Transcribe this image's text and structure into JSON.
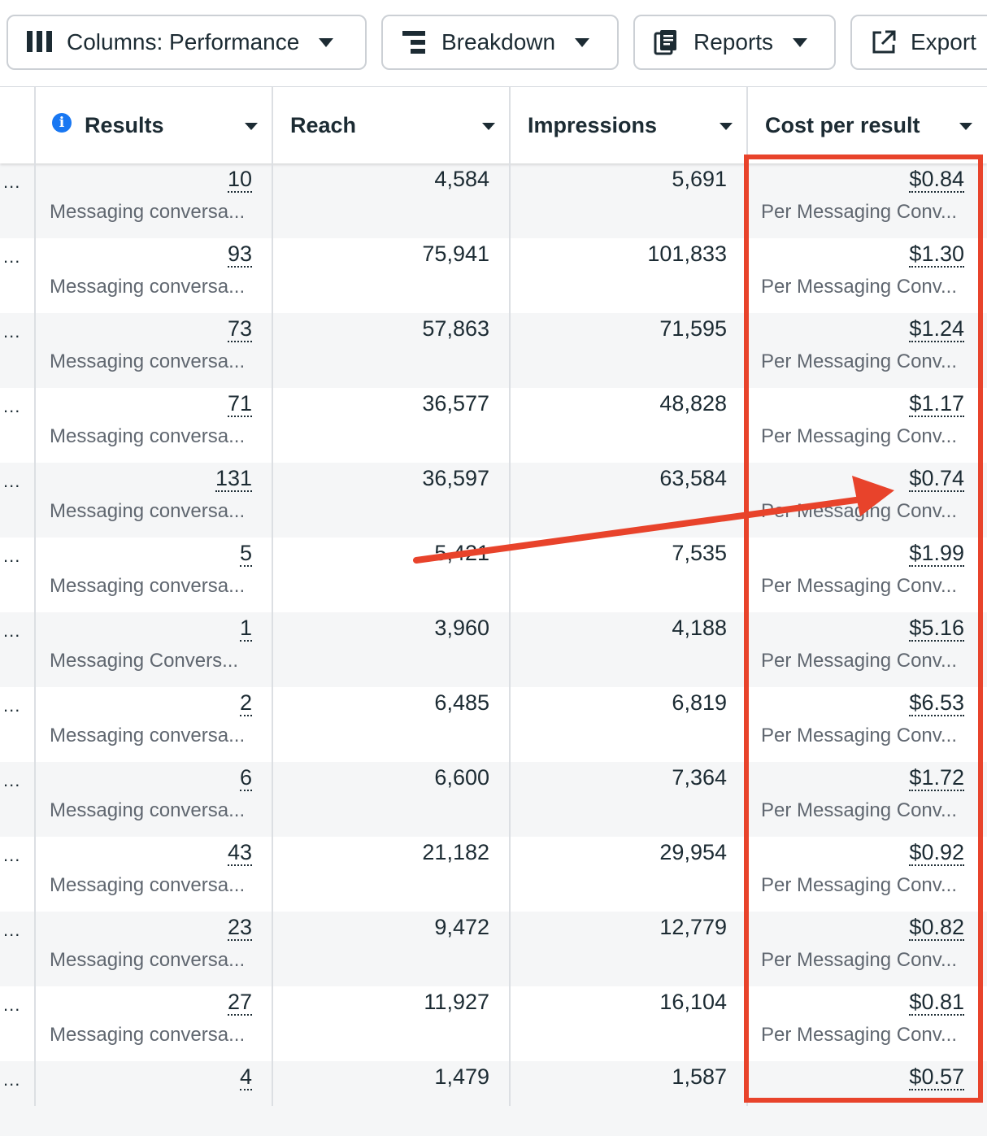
{
  "toolbar": {
    "columns_label": "Columns: Performance",
    "breakdown_label": "Breakdown",
    "reports_label": "Reports",
    "export_label": "Export"
  },
  "table": {
    "headers": {
      "results": "Results",
      "reach": "Reach",
      "impressions": "Impressions",
      "cost_per_result": "Cost per result"
    },
    "row_menu": "...",
    "rows": [
      {
        "results": "10",
        "results_type": "Messaging conversa...",
        "reach": "4,584",
        "impressions": "5,691",
        "cost": "$0.84",
        "cost_type": "Per Messaging Conv..."
      },
      {
        "results": "93",
        "results_type": "Messaging conversa...",
        "reach": "75,941",
        "impressions": "101,833",
        "cost": "$1.30",
        "cost_type": "Per Messaging Conv..."
      },
      {
        "results": "73",
        "results_type": "Messaging conversa...",
        "reach": "57,863",
        "impressions": "71,595",
        "cost": "$1.24",
        "cost_type": "Per Messaging Conv..."
      },
      {
        "results": "71",
        "results_type": "Messaging conversa...",
        "reach": "36,577",
        "impressions": "48,828",
        "cost": "$1.17",
        "cost_type": "Per Messaging Conv..."
      },
      {
        "results": "131",
        "results_type": "Messaging conversa...",
        "reach": "36,597",
        "impressions": "63,584",
        "cost": "$0.74",
        "cost_type": "Per Messaging Conv..."
      },
      {
        "results": "5",
        "results_type": "Messaging conversa...",
        "reach": "5,421",
        "impressions": "7,535",
        "cost": "$1.99",
        "cost_type": "Per Messaging Conv..."
      },
      {
        "results": "1",
        "results_type": "Messaging Convers...",
        "reach": "3,960",
        "impressions": "4,188",
        "cost": "$5.16",
        "cost_type": "Per Messaging Conv..."
      },
      {
        "results": "2",
        "results_type": "Messaging conversa...",
        "reach": "6,485",
        "impressions": "6,819",
        "cost": "$6.53",
        "cost_type": "Per Messaging Conv..."
      },
      {
        "results": "6",
        "results_type": "Messaging conversa...",
        "reach": "6,600",
        "impressions": "7,364",
        "cost": "$1.72",
        "cost_type": "Per Messaging Conv..."
      },
      {
        "results": "43",
        "results_type": "Messaging conversa...",
        "reach": "21,182",
        "impressions": "29,954",
        "cost": "$0.92",
        "cost_type": "Per Messaging Conv..."
      },
      {
        "results": "23",
        "results_type": "Messaging conversa...",
        "reach": "9,472",
        "impressions": "12,779",
        "cost": "$0.82",
        "cost_type": "Per Messaging Conv..."
      },
      {
        "results": "27",
        "results_type": "Messaging conversa...",
        "reach": "11,927",
        "impressions": "16,104",
        "cost": "$0.81",
        "cost_type": "Per Messaging Conv..."
      },
      {
        "results": "4",
        "results_type": "",
        "reach": "1,479",
        "impressions": "1,587",
        "cost": "$0.57",
        "cost_type": ""
      }
    ]
  },
  "annotation": {
    "highlight_color": "#e8432b",
    "arrow_color": "#e8432b"
  }
}
